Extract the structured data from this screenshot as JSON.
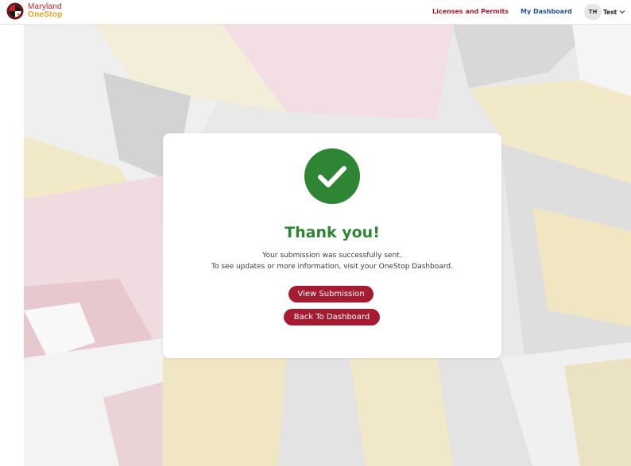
{
  "header": {
    "brand_line1": "Maryland",
    "brand_line2": "OneStop",
    "nav_licenses": "Licenses and Permits",
    "nav_dashboard": "My Dashboard",
    "user_initials": "TH",
    "user_name": "Test"
  },
  "confirmation": {
    "title": "Thank you!",
    "message_line1": "Your submission was successfully sent.",
    "message_line2": "To see updates or more information, visit your OneStop Dashboard.",
    "view_submission_label": "View Submission",
    "back_to_dashboard_label": "Back To Dashboard"
  },
  "icons": {
    "seal": "maryland-seal-icon",
    "user_menu": "chevron-down-icon",
    "success": "checkmark-circle-icon"
  },
  "colors": {
    "brand_red": "#b8232f",
    "brand_gold": "#e3a61e",
    "nav_link_red": "#a7192a",
    "nav_link_blue": "#1b4f9a",
    "success_green": "#2e8533",
    "button_red": "#a51b31"
  }
}
